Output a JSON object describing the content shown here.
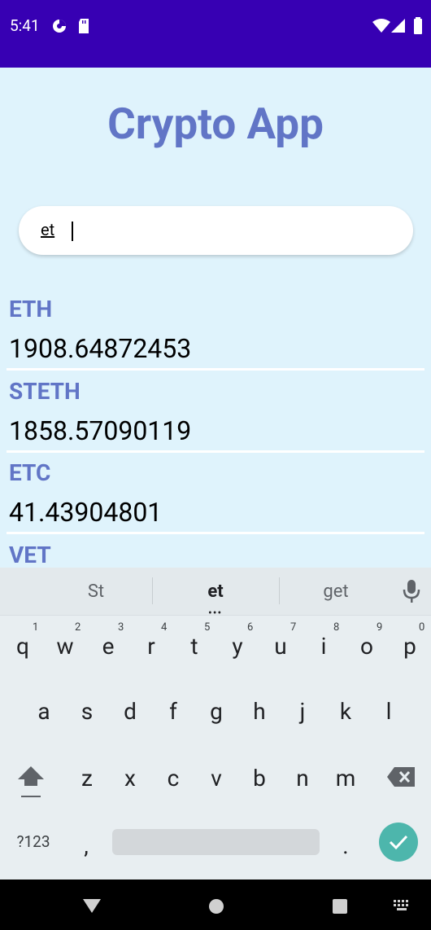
{
  "status_bar": {
    "time": "5:41"
  },
  "app": {
    "title": "Crypto App",
    "search_value": "et",
    "coins": [
      {
        "symbol": "ETH",
        "price": "1908.64872453"
      },
      {
        "symbol": "STETH",
        "price": "1858.57090119"
      },
      {
        "symbol": "ETC",
        "price": "41.43904801"
      },
      {
        "symbol": "VET",
        "price": ""
      }
    ]
  },
  "keyboard": {
    "suggestions": [
      "St",
      "et",
      "get"
    ],
    "row1": [
      "q",
      "w",
      "e",
      "r",
      "t",
      "y",
      "u",
      "i",
      "o",
      "p"
    ],
    "row1_numbers": [
      "1",
      "2",
      "3",
      "4",
      "5",
      "6",
      "7",
      "8",
      "9",
      "0"
    ],
    "row2": [
      "a",
      "s",
      "d",
      "f",
      "g",
      "h",
      "j",
      "k",
      "l"
    ],
    "row3": [
      "z",
      "x",
      "c",
      "v",
      "b",
      "n",
      "m"
    ],
    "symbols_key": "?123",
    "comma_key": ",",
    "period_key": "."
  }
}
